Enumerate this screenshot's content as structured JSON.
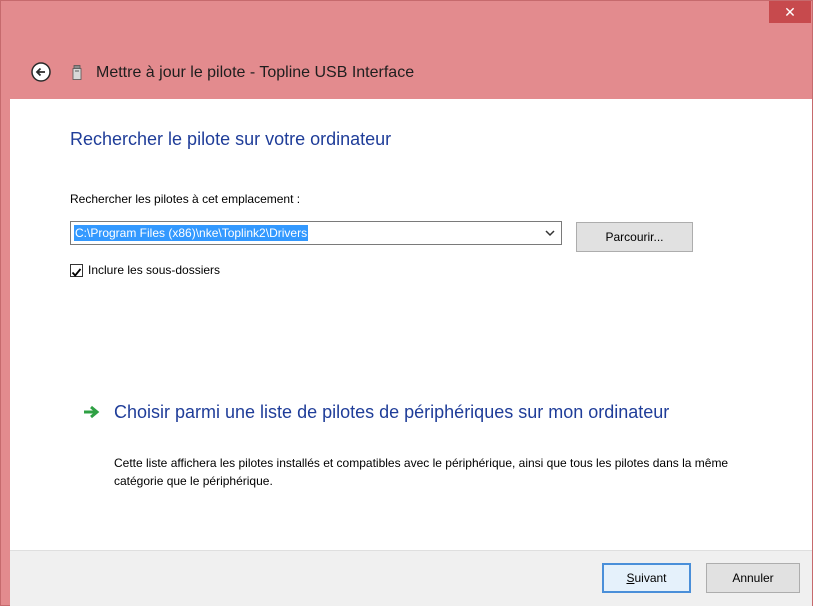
{
  "window": {
    "title": "Mettre à jour le pilote - Topline USB Interface",
    "close_glyph": "✕"
  },
  "page": {
    "heading": "Rechercher le pilote sur votre ordinateur",
    "location_label": "Rechercher les pilotes à cet emplacement :",
    "path_value": "C:\\Program Files (x86)\\nke\\Toplink2\\Drivers",
    "browse_label": "Parcourir...",
    "include_subfolders_label": "Inclure les sous-dossiers",
    "include_subfolders_checked": true,
    "option_title": "Choisir parmi une liste de pilotes de périphériques sur mon ordinateur",
    "option_description": "Cette liste affichera les pilotes installés et compatibles avec le périphérique, ainsi que tous les pilotes dans la même catégorie que le périphérique."
  },
  "footer": {
    "next_label": "Suivant",
    "cancel_label": "Annuler"
  },
  "colors": {
    "titlebar": "#e38b8e",
    "close_button": "#c74a4d",
    "heading_blue": "#1f3d99",
    "selection_blue": "#3399ff",
    "arrow_green": "#2ea043"
  },
  "icons": {
    "back": "back-arrow-circle-icon",
    "device": "usb-device-icon",
    "option": "green-arrow-icon",
    "dropdown": "chevron-down-icon",
    "check": "checkmark-icon"
  }
}
